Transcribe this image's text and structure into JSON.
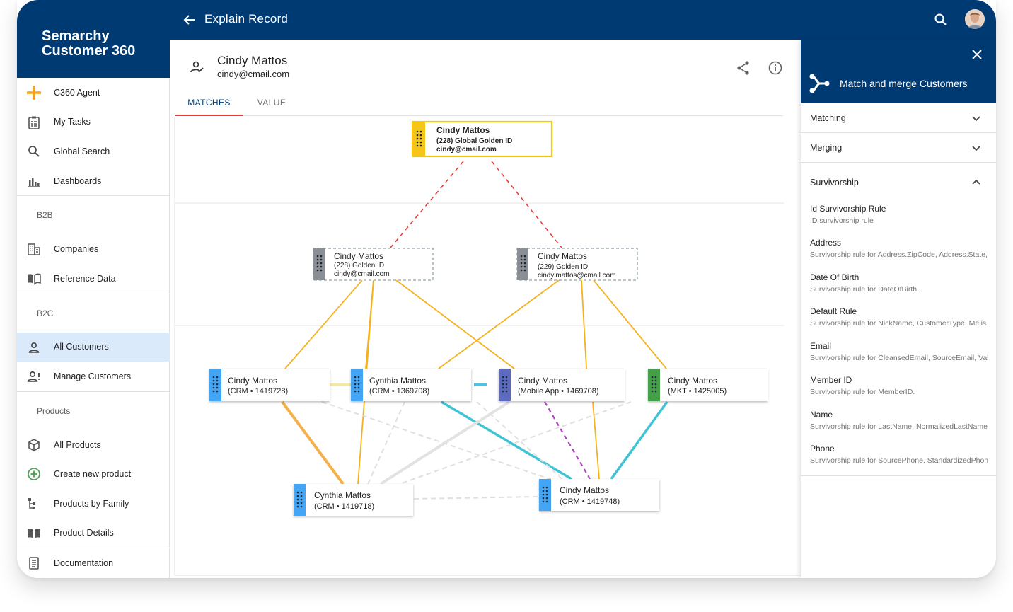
{
  "app": {
    "brand_line1": "Semarchy",
    "brand_line2": "Customer 360",
    "page_title": "Explain Record",
    "accent_color": "#003a73"
  },
  "sidebar": {
    "items": [
      {
        "label": "C360 Agent",
        "icon": "sparkle-icon"
      },
      {
        "label": "My Tasks",
        "icon": "clipboard-icon"
      },
      {
        "label": "Global Search",
        "icon": "search-icon"
      },
      {
        "label": "Dashboards",
        "icon": "bar-chart-icon"
      }
    ],
    "section_b2b": "B2B",
    "b2b_items": [
      {
        "label": "Companies",
        "icon": "building-icon"
      },
      {
        "label": "Reference Data",
        "icon": "book-icon"
      }
    ],
    "section_b2c": "B2C",
    "b2c_items": [
      {
        "label": "All Customers",
        "icon": "person-icon",
        "active": true
      },
      {
        "label": "Manage Customers",
        "icon": "person-alert-icon"
      }
    ],
    "section_products": "Products",
    "product_items": [
      {
        "label": "All Products",
        "icon": "cube-icon"
      },
      {
        "label": "Create new product",
        "icon": "plus-circle-icon"
      },
      {
        "label": "Products by Family",
        "icon": "tree-icon"
      },
      {
        "label": "Product Details",
        "icon": "book-open-icon"
      }
    ],
    "doc_item": {
      "label": "Documentation",
      "icon": "document-icon"
    }
  },
  "record": {
    "name": "Cindy Mattos",
    "email": "cindy@cmail.com"
  },
  "tabs": [
    {
      "label": "MATCHES",
      "active": true
    },
    {
      "label": "VALUE",
      "active": false
    }
  ],
  "graph": {
    "golden": {
      "name": "Cindy Mattos",
      "line2": "(228) Global Golden ID",
      "line3": "cindy@cmail.com"
    },
    "goldens": [
      {
        "name": "Cindy Mattos",
        "line2": "(228) Golden ID",
        "line3": "cindy@cmail.com"
      },
      {
        "name": "Cindy Mattos",
        "line2": "(229) Golden ID",
        "line3": "cindy.mattos@cmail.com"
      }
    ],
    "masters": [
      {
        "name": "Cindy Mattos",
        "line2": "(CRM • 1419728)",
        "color": "#42a5f5"
      },
      {
        "name": "Cynthia Mattos",
        "line2": "(CRM • 1369708)",
        "color": "#42a5f5"
      },
      {
        "name": "Cindy Mattos",
        "line2": "(Mobile App • 1469708)",
        "color": "#5c6bc0"
      },
      {
        "name": "Cindy Mattos",
        "line2": "(MKT • 1425005)",
        "color": "#43a047"
      }
    ],
    "bottom": [
      {
        "name": "Cynthia Mattos",
        "line2": "(CRM • 1419718)",
        "color": "#42a5f5"
      },
      {
        "name": "Cindy Mattos",
        "line2": "(CRM • 1419748)",
        "color": "#42a5f5"
      }
    ]
  },
  "panel": {
    "title": "Match and merge Customers",
    "matching": "Matching",
    "merging": "Merging",
    "survivorship": "Survivorship",
    "rules": [
      {
        "name": "Id Survivorship Rule",
        "desc": "ID survivorship rule"
      },
      {
        "name": "Address",
        "desc": "Survivorship rule for Address.ZipCode, Address.State,"
      },
      {
        "name": "Date Of Birth",
        "desc": "Survivorship rule for DateOfBirth."
      },
      {
        "name": "Default Rule",
        "desc": "Survivorship rule for NickName, CustomerType, Melis"
      },
      {
        "name": "Email",
        "desc": "Survivorship rule for CleansedEmail, SourceEmail, Val"
      },
      {
        "name": "Member ID",
        "desc": "Survivorship rule for MemberID."
      },
      {
        "name": "Name",
        "desc": "Survivorship rule for LastName, NormalizedLastName"
      },
      {
        "name": "Phone",
        "desc": "Survivorship rule for SourcePhone, StandardizedPhon"
      }
    ]
  }
}
